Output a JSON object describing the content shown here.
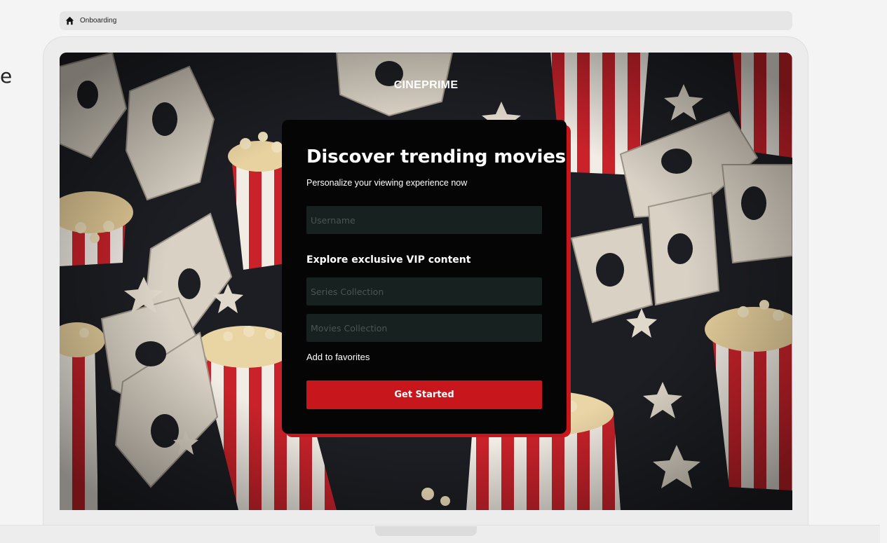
{
  "page": {
    "stray_char": "e",
    "breadcrumb": {
      "icon": "home-icon",
      "label": "Onboarding"
    }
  },
  "screen": {
    "brand": "CINEPRIME",
    "background": "popcorn-and-3d-glasses-pattern"
  },
  "card": {
    "title": "Discover trending movies",
    "subtitle": "Personalize your viewing experience now",
    "username_placeholder": "Username",
    "section_label": "Explore exclusive VIP content",
    "series_placeholder": "Series Collection",
    "movies_placeholder": "Movies Collection",
    "favorites_link": "Add to favorites",
    "cta_label": "Get Started"
  },
  "colors": {
    "accent": "#c8161d",
    "card_bg": "#050506",
    "field_bg": "#17211f",
    "page_bg": "#f4f4f4"
  }
}
